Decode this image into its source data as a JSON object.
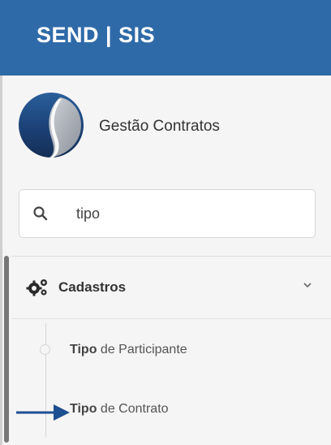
{
  "header": {
    "brand": "SEND | SIS",
    "background_color": "#2f6aa8"
  },
  "profile": {
    "name": "Gestão Contratos",
    "logo_icon": "company-logo"
  },
  "search": {
    "value": "tipo",
    "icon": "search-icon"
  },
  "menu": {
    "section_label": "Cadastros",
    "section_icon": "gears-icon",
    "expand_icon": "chevron-down-icon",
    "items": [
      {
        "match": "Tipo",
        "rest": " de Participante"
      },
      {
        "match": "Tipo",
        "rest": " de Contrato"
      }
    ]
  },
  "annotation": {
    "icon": "arrow-right-icon",
    "color": "#1e4f91"
  }
}
